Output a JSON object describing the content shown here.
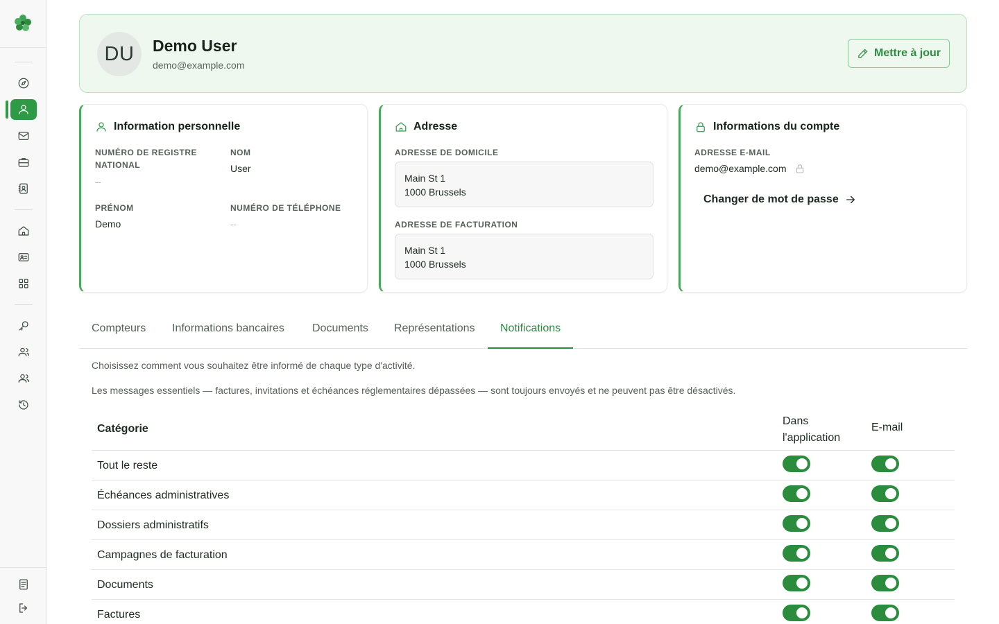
{
  "colors": {
    "accent": "#2f9a46",
    "accent_dark": "#2b8c3e",
    "header_bg": "#eef8ef"
  },
  "sidebar": {
    "items": [
      {
        "name": "compass-icon",
        "active": false
      },
      {
        "name": "user-icon",
        "active": true
      },
      {
        "name": "mail-icon",
        "active": false
      },
      {
        "name": "briefcase-icon",
        "active": false
      },
      {
        "name": "contact-book-icon",
        "active": false
      },
      {
        "name": "home-icon",
        "active": false
      },
      {
        "name": "id-card-icon",
        "active": false
      },
      {
        "name": "grid-icon",
        "active": false
      },
      {
        "name": "key-icon",
        "active": false
      },
      {
        "name": "users-icon",
        "active": false
      },
      {
        "name": "team-icon",
        "active": false
      },
      {
        "name": "history-icon",
        "active": false
      },
      {
        "name": "document-icon",
        "active": false
      },
      {
        "name": "logout-icon",
        "active": false
      }
    ]
  },
  "profile": {
    "initials": "DU",
    "name": "Demo User",
    "email": "demo@example.com",
    "update_label": "Mettre à jour"
  },
  "personal": {
    "title": "Information personnelle",
    "national_register_label": "Numéro de registre national",
    "national_register_value": "--",
    "last_name_label": "Nom",
    "last_name_value": "User",
    "first_name_label": "Prénom",
    "first_name_value": "Demo",
    "phone_label": "Numéro de téléphone",
    "phone_value": "--"
  },
  "address": {
    "title": "Adresse",
    "home_label": "Adresse de domicile",
    "home_line1": "Main St 1",
    "home_line2": "1000 Brussels",
    "billing_label": "Adresse de facturation",
    "billing_line1": "Main St 1",
    "billing_line2": "1000 Brussels"
  },
  "account": {
    "title": "Informations du compte",
    "email_label": "Adresse e-mail",
    "email_value": "demo@example.com",
    "change_password_label": "Changer de mot de passe"
  },
  "tabs": [
    {
      "label": "Compteurs",
      "active": false
    },
    {
      "label": "Informations bancaires",
      "active": false
    },
    {
      "label": "Documents",
      "active": false
    },
    {
      "label": "Représentations",
      "active": false
    },
    {
      "label": "Notifications",
      "active": true
    }
  ],
  "notifications": {
    "intro": "Choisissez comment vous souhaitez être informé de chaque type d'activité.",
    "note": "Les messages essentiels — factures, invitations et échéances réglementaires dépassées — sont toujours envoyés et ne peuvent pas être désactivés.",
    "col_category": "Catégorie",
    "col_app_line1": "Dans",
    "col_app_line2": "l'application",
    "col_email": "E-mail",
    "rows": [
      {
        "category": "Tout le reste",
        "in_app": true,
        "email": true
      },
      {
        "category": "Échéances administratives",
        "in_app": true,
        "email": true
      },
      {
        "category": "Dossiers administratifs",
        "in_app": true,
        "email": true
      },
      {
        "category": "Campagnes de facturation",
        "in_app": true,
        "email": true
      },
      {
        "category": "Documents",
        "in_app": true,
        "email": true
      },
      {
        "category": "Factures",
        "in_app": true,
        "email": true
      }
    ]
  }
}
